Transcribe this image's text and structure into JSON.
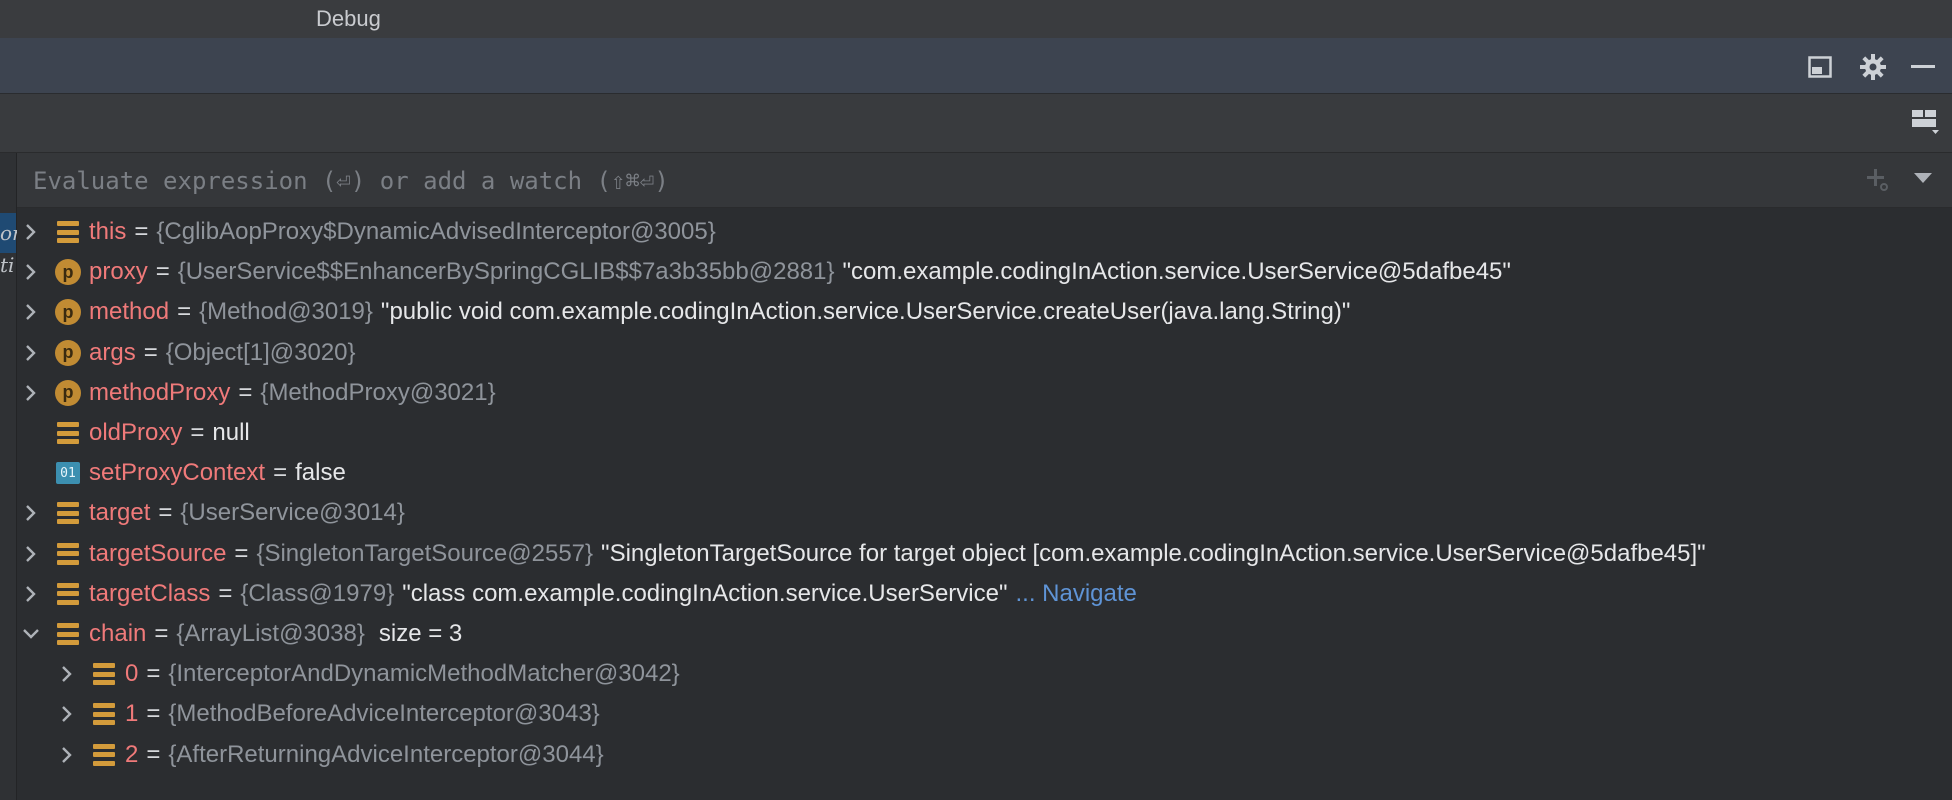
{
  "window": {
    "title": "Debug"
  },
  "toolbar": {
    "icons": [
      "layout-icon",
      "gear-icon",
      "minimize-icon"
    ],
    "subbar_icon": "layout-settings-icon"
  },
  "gutter": {
    "fragments": [
      "or",
      "ti"
    ]
  },
  "evaluate": {
    "placeholder": "Evaluate expression (⏎) or add a watch (⇧⌘⏎)"
  },
  "variables": [
    {
      "expandable": true,
      "expanded": false,
      "icon": "field",
      "name": "this",
      "type": "{CglibAopProxy$DynamicAdvisedInterceptor@3005}",
      "value": ""
    },
    {
      "expandable": true,
      "expanded": false,
      "icon": "param",
      "name": "proxy",
      "type": "{UserService$$EnhancerBySpringCGLIB$$7a3b35bb@2881}",
      "value": "\"com.example.codingInAction.service.UserService@5dafbe45\""
    },
    {
      "expandable": true,
      "expanded": false,
      "icon": "param",
      "name": "method",
      "type": "{Method@3019}",
      "value": "\"public void com.example.codingInAction.service.UserService.createUser(java.lang.String)\""
    },
    {
      "expandable": true,
      "expanded": false,
      "icon": "param",
      "name": "args",
      "type": "{Object[1]@3020}",
      "value": ""
    },
    {
      "expandable": true,
      "expanded": false,
      "icon": "param",
      "name": "methodProxy",
      "type": "{MethodProxy@3021}",
      "value": ""
    },
    {
      "expandable": false,
      "expanded": false,
      "icon": "field",
      "name": "oldProxy",
      "type": "",
      "value": "null"
    },
    {
      "expandable": false,
      "expanded": false,
      "icon": "bool",
      "name": "setProxyContext",
      "type": "",
      "value": "false"
    },
    {
      "expandable": true,
      "expanded": false,
      "icon": "field",
      "name": "target",
      "type": "{UserService@3014}",
      "value": ""
    },
    {
      "expandable": true,
      "expanded": false,
      "icon": "field",
      "name": "targetSource",
      "type": "{SingletonTargetSource@2557}",
      "value": "\"SingletonTargetSource for target object [com.example.codingInAction.service.UserService@5dafbe45]\""
    },
    {
      "expandable": true,
      "expanded": false,
      "icon": "field",
      "name": "targetClass",
      "type": "{Class@1979}",
      "value": "\"class com.example.codingInAction.service.UserService\"",
      "link": "... Navigate"
    },
    {
      "expandable": true,
      "expanded": true,
      "icon": "field",
      "name": "chain",
      "type": "{ArrayList@3038}",
      "value": "",
      "size": "size = 3"
    },
    {
      "expandable": true,
      "expanded": false,
      "icon": "field",
      "indent": 1,
      "name": "0",
      "type": "{InterceptorAndDynamicMethodMatcher@3042}",
      "value": ""
    },
    {
      "expandable": true,
      "expanded": false,
      "icon": "field",
      "indent": 1,
      "name": "1",
      "type": "{MethodBeforeAdviceInterceptor@3043}",
      "value": ""
    },
    {
      "expandable": true,
      "expanded": false,
      "icon": "field",
      "indent": 1,
      "name": "2",
      "type": "{AfterReturningAdviceInterceptor@3044}",
      "value": ""
    }
  ],
  "icon_labels": {
    "param": "p",
    "bool": "01"
  }
}
